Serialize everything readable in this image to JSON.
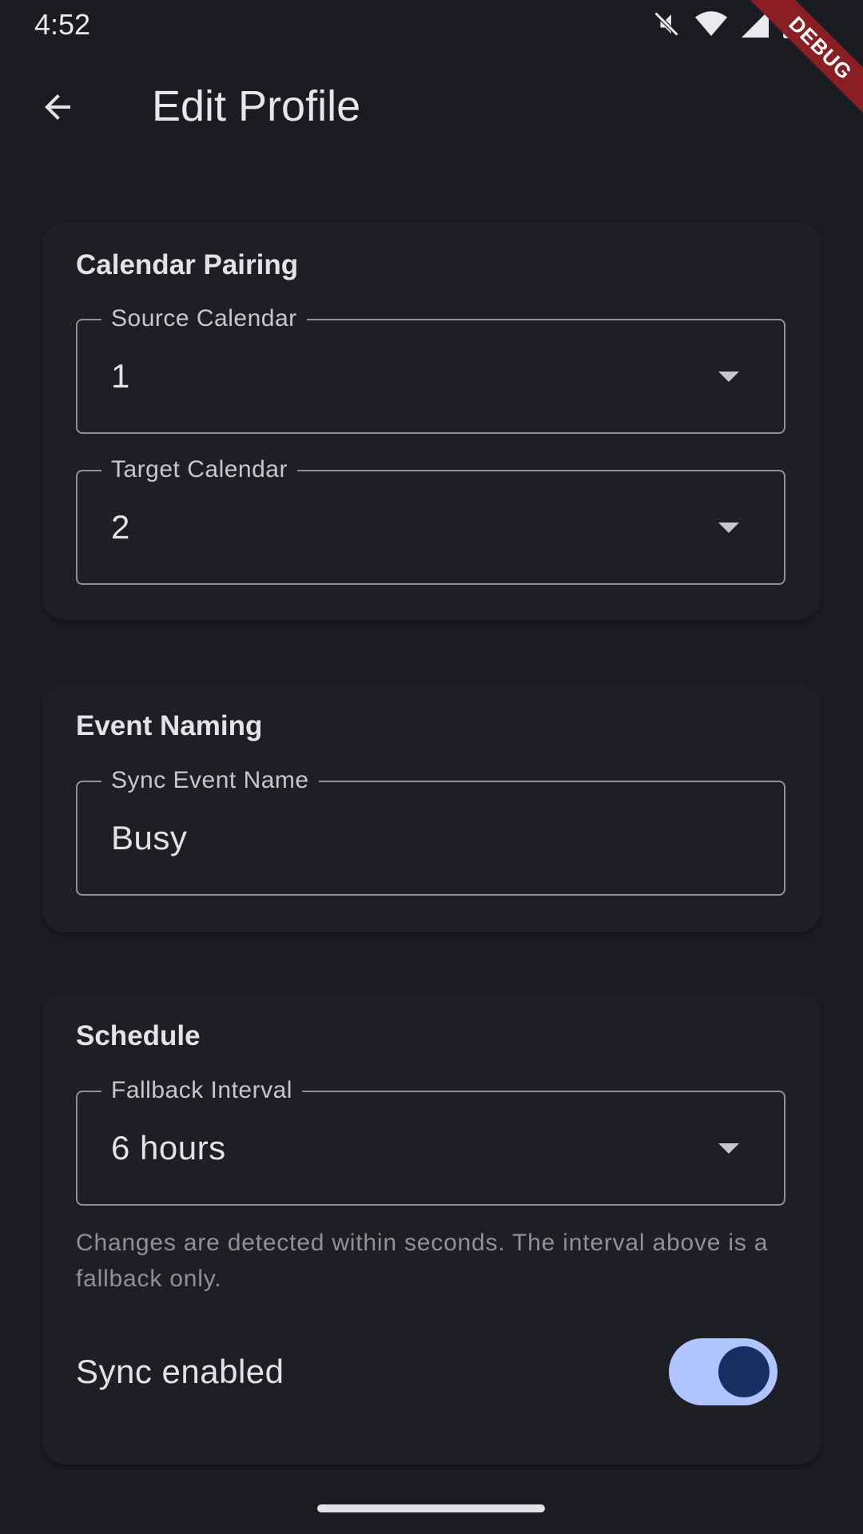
{
  "status_bar": {
    "time": "4:52",
    "icons": [
      "mute-icon",
      "wifi-icon",
      "cellular-icon",
      "battery-icon"
    ]
  },
  "debug_banner": {
    "label": "DEBUG"
  },
  "app_bar": {
    "back_icon": "arrow-back-icon",
    "title": "Edit Profile"
  },
  "calendar_pairing": {
    "title": "Calendar Pairing",
    "source": {
      "label": "Source Calendar",
      "value": "1"
    },
    "target": {
      "label": "Target Calendar",
      "value": "2"
    }
  },
  "event_naming": {
    "title": "Event Naming",
    "sync_event_name": {
      "label": "Sync Event Name",
      "value": "Busy"
    }
  },
  "schedule": {
    "title": "Schedule",
    "fallback_interval": {
      "label": "Fallback Interval",
      "value": "6 hours"
    },
    "helper": "Changes are detected within seconds. The interval above is a fallback only.",
    "sync_enabled": {
      "label": "Sync enabled",
      "on": true
    }
  },
  "colors": {
    "background": "#1b1c21",
    "card": "#1e1f25",
    "outline": "#8f9099",
    "switch_track": "#b0c4ff",
    "switch_thumb": "#173063",
    "debug_ribbon": "#8b1e22"
  }
}
